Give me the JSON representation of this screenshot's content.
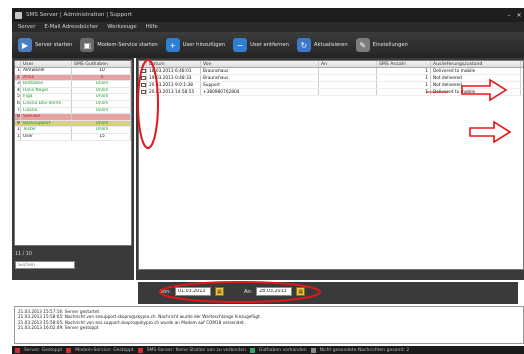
{
  "window": {
    "title": "SMS Server | Administration | Support",
    "controls": [
      "–",
      "✕"
    ]
  },
  "menu": [
    "Server",
    "E-Mail Adressbücher",
    "Werkzeuge",
    "Hilfe"
  ],
  "toolbar": [
    {
      "label": "Server starten",
      "icon": "server-start-icon",
      "color": "#4a7fc0",
      "glyph": "▶"
    },
    {
      "label": "Modem-Service starten",
      "icon": "modem-icon",
      "color": "#6a6a6a",
      "glyph": "▣"
    },
    {
      "label": "User hinzufügen",
      "icon": "user-add-icon",
      "color": "#2f7fd0",
      "glyph": "+"
    },
    {
      "label": "User entfernen",
      "icon": "user-remove-icon",
      "color": "#2f7fd0",
      "glyph": "−"
    },
    {
      "label": "Aktualisieren",
      "icon": "refresh-icon",
      "color": "#3f77c4",
      "glyph": "↻"
    },
    {
      "label": "Einstellungen",
      "icon": "tools-icon",
      "color": "#7c7c7c",
      "glyph": "✎"
    }
  ],
  "users": {
    "headers": [
      "",
      "User",
      "SMS Guthaben"
    ],
    "rows": [
      {
        "num": "1",
        "user": "Almwandl",
        "credit": "10",
        "style": ""
      },
      {
        "num": "2",
        "user": "Anna",
        "credit": "0",
        "style": "sel red"
      },
      {
        "num": "3",
        "user": "Bretzeles",
        "credit": "Unlim",
        "style": "green"
      },
      {
        "num": "4",
        "user": "Hans Nagel",
        "credit": "Unlim",
        "style": "green"
      },
      {
        "num": "5",
        "user": "Inga",
        "credit": "Unlim",
        "style": "green"
      },
      {
        "num": "6",
        "user": "Liliana Dev-iberle",
        "credit": "Unlim",
        "style": "green"
      },
      {
        "num": "7",
        "user": "Liliana",
        "credit": "Unlim",
        "style": "green"
      },
      {
        "num": "8",
        "user": "Seeuwe",
        "credit": "",
        "style": "sel red"
      },
      {
        "num": "9",
        "user": "Backsupport",
        "credit": "Unlim",
        "style": "sel2 green"
      },
      {
        "num": "10",
        "user": "Tester",
        "credit": "Unlim",
        "style": "green"
      },
      {
        "num": "11",
        "user": "User",
        "credit": "15",
        "style": ""
      }
    ],
    "count": "11 / 10",
    "search_placeholder": "Suchen"
  },
  "messages": {
    "headers": [
      "",
      "Datum",
      "Von",
      "An",
      "SMS Anzahl",
      "Auslieferungszustand"
    ],
    "rows": [
      {
        "date": "18.03.2013 6:48:01",
        "from": "Braunshaus",
        "to": "",
        "count": "1",
        "state": "Delivered to mobile"
      },
      {
        "date": "19.03.2013 0:48:33",
        "from": "Braunshaus",
        "to": "",
        "count": "1",
        "state": "Not delivered"
      },
      {
        "date": "20.03.2013 9:0:1:38",
        "from": "Support",
        "to": "",
        "count": "1",
        "state": "Not delivered"
      },
      {
        "date": "20.03.2013 14:58:55",
        "from": "+380980702804",
        "to": "",
        "count": "1",
        "state": "Delivered to mobile"
      }
    ]
  },
  "filter": {
    "from_label": "Von:",
    "from_value": "01.03.2013",
    "to_label": "An:",
    "to_value": "28.03.2013"
  },
  "log": [
    "21.03.2013 15:57:16: Server gestartet",
    "21.03.2013 15:58:05: Nachricht von sesupport.skopro@skypro.ch. Nachricht wurde der Warteschlange hinzugefügt.",
    "21.03.2013 15:58:05: Nachricht von ess.support.skopro@skypro.ch wurde an Modem auf COM18 versendet.",
    "21.03.2013 16:02:49: Server gestoppt"
  ],
  "status": [
    {
      "label": "Server: Gestoppt",
      "color": "#d23030"
    },
    {
      "label": "Modem-Service: Gestoppt",
      "color": "#d23030"
    },
    {
      "label": "SMS-Server: Keine Station von zu verbinden",
      "color": "#d23030"
    },
    {
      "label": "Guthaben vorhanden",
      "color": "#2fa86a"
    },
    {
      "label": "Nicht gesendete Nachrichten gesamt: 2",
      "color": "#888888"
    }
  ],
  "annotation_color": "#e01818"
}
